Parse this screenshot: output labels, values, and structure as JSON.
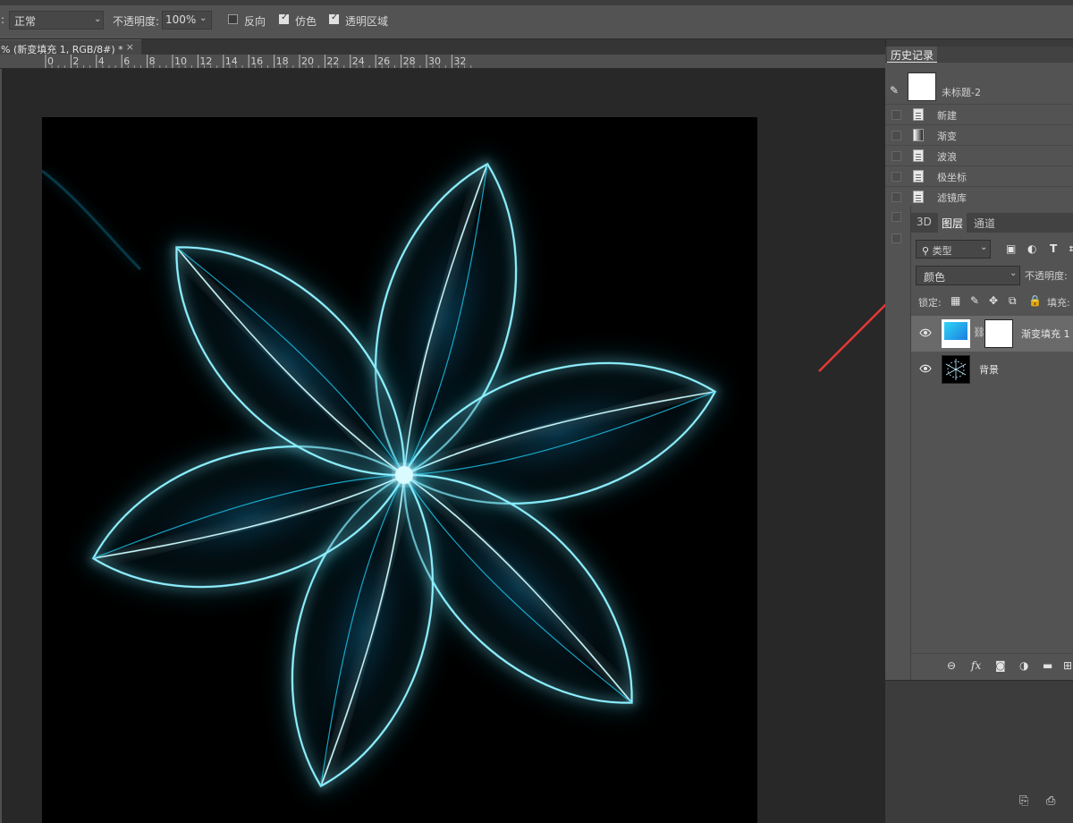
{
  "options_bar": {
    "mode_prefix": ":",
    "mode_value": "正常",
    "opacity_label": "不透明度:",
    "opacity_value": "100%",
    "reverse_label": "反向",
    "dither_label": "仿色",
    "transparency_label": "透明区域"
  },
  "document_tab": {
    "title": "% (新变填充 1, RGB/8#) *",
    "close": "×"
  },
  "ruler": {
    "ticks": [
      "0",
      "2",
      "4",
      "6",
      "8",
      "10",
      "12",
      "14",
      "16",
      "18",
      "20",
      "22",
      "24",
      "26",
      "28",
      "30",
      "32"
    ]
  },
  "history_panel": {
    "tab_label": "历史记录",
    "snapshot_label": "未标题-2",
    "items": [
      "新建",
      "渐变",
      "波浪",
      "极坐标",
      "滤镜库"
    ]
  },
  "layers_panel": {
    "tabs": [
      "3D",
      "图层",
      "通道"
    ],
    "filter_value": "类型",
    "blend_mode": "颜色",
    "opacity_label": "不透明度:",
    "lock_label": "锁定:",
    "fill_label": "填充:",
    "layers": [
      {
        "name": "渐变填充 1",
        "selected": true
      },
      {
        "name": "背景",
        "selected": false
      }
    ]
  },
  "colors": {
    "glow": "#1ec8f0",
    "arrow": "#e53935"
  }
}
